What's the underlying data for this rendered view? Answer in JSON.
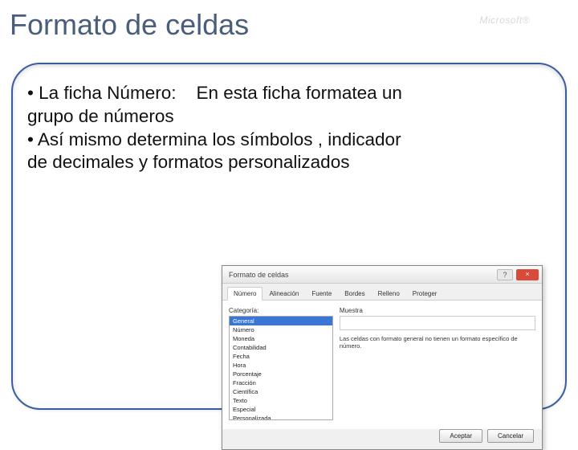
{
  "title": "Formato de celdas",
  "watermark": "Microsoft®",
  "bullets": {
    "line1a": "• La ficha Número:",
    "line1b": "En esta ficha formatea un",
    "line2": "grupo de números",
    "line3": "• Así  mismo determina los símbolos , indicador",
    "line4": "de decimales y formatos personalizados"
  },
  "dialog": {
    "title": "Formato de celdas",
    "help": "?",
    "close": "×",
    "tabs": {
      "t0": "Número",
      "t1": "Alineación",
      "t2": "Fuente",
      "t3": "Bordes",
      "t4": "Relleno",
      "t5": "Proteger"
    },
    "category_label": "Categoría:",
    "categories": {
      "c0": "General",
      "c1": "Número",
      "c2": "Moneda",
      "c3": "Contabilidad",
      "c4": "Fecha",
      "c5": "Hora",
      "c6": "Porcentaje",
      "c7": "Fracción",
      "c8": "Científica",
      "c9": "Texto",
      "c10": "Especial",
      "c11": "Personalizada"
    },
    "sample_label": "Muestra",
    "sample_desc": "Las celdas con formato general no tienen un formato específico de número.",
    "btn_ok": "Aceptar",
    "btn_cancel": "Cancelar"
  }
}
